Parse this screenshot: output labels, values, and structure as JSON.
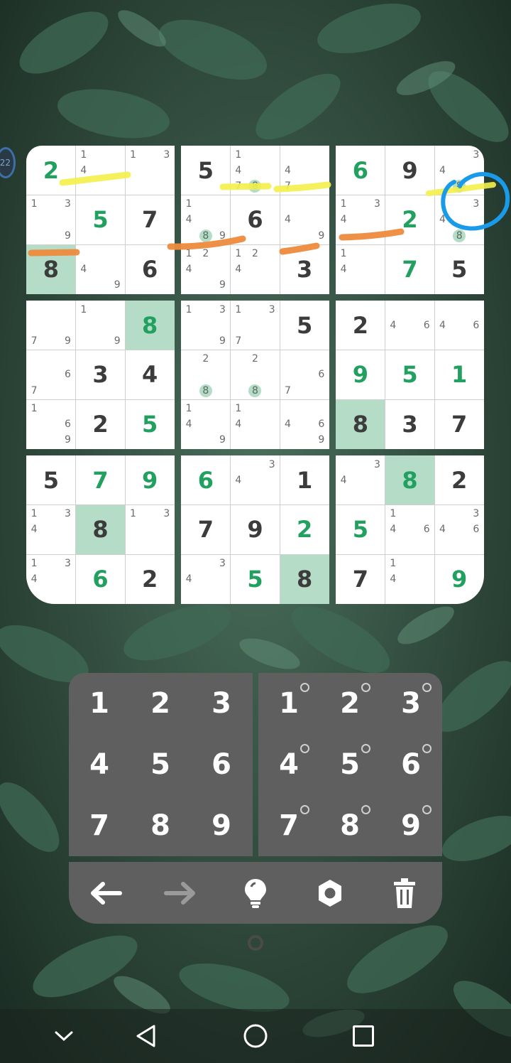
{
  "board": {
    "cells": [
      [
        {
          "v": "2",
          "k": "user"
        },
        {
          "n": [
            "1",
            "4"
          ]
        },
        {
          "n": [
            "1",
            "3"
          ]
        },
        {
          "v": "5",
          "k": "given"
        },
        {
          "n": [
            "1",
            "4",
            "7",
            "8"
          ],
          "d": [
            "8"
          ]
        },
        {
          "n": [
            "4",
            "7"
          ]
        },
        {
          "v": "6",
          "k": "user"
        },
        {
          "v": "9",
          "k": "given"
        },
        {
          "n": [
            "3",
            "4",
            "8"
          ],
          "d": [
            "8"
          ]
        }
      ],
      [
        {
          "n": [
            "1",
            "3",
            "9"
          ]
        },
        {
          "v": "5",
          "k": "user"
        },
        {
          "v": "7",
          "k": "given"
        },
        {
          "n": [
            "1",
            "4",
            "8",
            "9"
          ],
          "d": [
            "8"
          ]
        },
        {
          "v": "6",
          "k": "given"
        },
        {
          "n": [
            "4",
            "9"
          ]
        },
        {
          "n": [
            "1",
            "3",
            "4"
          ]
        },
        {
          "v": "2",
          "k": "user"
        },
        {
          "n": [
            "3",
            "4",
            "8"
          ],
          "d": [
            "8"
          ]
        }
      ],
      [
        {
          "v": "8",
          "k": "given",
          "hl": true
        },
        {
          "n": [
            "4",
            "9"
          ]
        },
        {
          "v": "6",
          "k": "given"
        },
        {
          "n": [
            "1",
            "2",
            "4",
            "9"
          ]
        },
        {
          "n": [
            "1",
            "2",
            "4"
          ]
        },
        {
          "v": "3",
          "k": "given"
        },
        {
          "n": [
            "1",
            "4"
          ]
        },
        {
          "v": "7",
          "k": "user"
        },
        {
          "v": "5",
          "k": "given"
        }
      ],
      [
        {
          "n": [
            "7",
            "9"
          ]
        },
        {
          "n": [
            "1",
            "9"
          ]
        },
        {
          "v": "8",
          "k": "user",
          "hl": true
        },
        {
          "n": [
            "1",
            "3",
            "9"
          ]
        },
        {
          "n": [
            "1",
            "3",
            "7"
          ]
        },
        {
          "v": "5",
          "k": "given"
        },
        {
          "v": "2",
          "k": "given"
        },
        {
          "n": [
            "4",
            "6"
          ]
        },
        {
          "n": [
            "4",
            "6"
          ]
        }
      ],
      [
        {
          "n": [
            "6",
            "7"
          ]
        },
        {
          "v": "3",
          "k": "given"
        },
        {
          "v": "4",
          "k": "given"
        },
        {
          "n": [
            "2",
            "8"
          ],
          "d": [
            "8"
          ]
        },
        {
          "n": [
            "2",
            "8"
          ],
          "d": [
            "8"
          ]
        },
        {
          "n": [
            "6",
            "7"
          ]
        },
        {
          "v": "9",
          "k": "user"
        },
        {
          "v": "5",
          "k": "user"
        },
        {
          "v": "1",
          "k": "user"
        }
      ],
      [
        {
          "n": [
            "1",
            "6",
            "9"
          ]
        },
        {
          "v": "2",
          "k": "given"
        },
        {
          "v": "5",
          "k": "user"
        },
        {
          "n": [
            "1",
            "4",
            "9"
          ]
        },
        {
          "n": [
            "1",
            "4"
          ]
        },
        {
          "n": [
            "4",
            "6",
            "9"
          ]
        },
        {
          "v": "8",
          "k": "given",
          "hl": true
        },
        {
          "v": "3",
          "k": "given"
        },
        {
          "v": "7",
          "k": "given"
        }
      ],
      [
        {
          "v": "5",
          "k": "given"
        },
        {
          "v": "7",
          "k": "user"
        },
        {
          "v": "9",
          "k": "user"
        },
        {
          "v": "6",
          "k": "user"
        },
        {
          "n": [
            "3",
            "4"
          ]
        },
        {
          "v": "1",
          "k": "given"
        },
        {
          "n": [
            "3",
            "4"
          ]
        },
        {
          "v": "8",
          "k": "user",
          "hl": true
        },
        {
          "v": "2",
          "k": "given"
        }
      ],
      [
        {
          "n": [
            "1",
            "3",
            "4"
          ]
        },
        {
          "v": "8",
          "k": "given",
          "hl": true
        },
        {
          "n": [
            "1",
            "3"
          ]
        },
        {
          "v": "7",
          "k": "given"
        },
        {
          "v": "9",
          "k": "given"
        },
        {
          "v": "2",
          "k": "user"
        },
        {
          "v": "5",
          "k": "user"
        },
        {
          "n": [
            "1",
            "4",
            "6"
          ]
        },
        {
          "n": [
            "3",
            "4",
            "6"
          ]
        }
      ],
      [
        {
          "n": [
            "1",
            "3",
            "4"
          ]
        },
        {
          "v": "6",
          "k": "user"
        },
        {
          "v": "2",
          "k": "given"
        },
        {
          "n": [
            "3",
            "4"
          ]
        },
        {
          "v": "5",
          "k": "user"
        },
        {
          "v": "8",
          "k": "given",
          "hl": true
        },
        {
          "v": "7",
          "k": "given"
        },
        {
          "n": [
            "1",
            "4"
          ]
        },
        {
          "v": "9",
          "k": "user"
        }
      ]
    ]
  },
  "keypad": {
    "digits": [
      "1",
      "2",
      "3",
      "4",
      "5",
      "6",
      "7",
      "8",
      "9"
    ],
    "note_digits": [
      "1",
      "2",
      "3",
      "4",
      "5",
      "6",
      "7",
      "8",
      "9"
    ]
  },
  "toolbar": {
    "undo_icon": "arrow-left-icon",
    "redo_icon": "arrow-right-icon",
    "hint_icon": "lightbulb-icon",
    "settings_icon": "gear-icon",
    "delete_icon": "trash-icon"
  },
  "badge": {
    "text": "22"
  },
  "colors": {
    "given_digit": "#3c3c3c",
    "user_digit": "#21a060",
    "highlight": "#b5dcc7",
    "panel": "#5f5f5f",
    "annotation_yellow": "#f3ef4a",
    "annotation_orange": "#ee8a3d",
    "annotation_blue": "#1a9bea"
  }
}
